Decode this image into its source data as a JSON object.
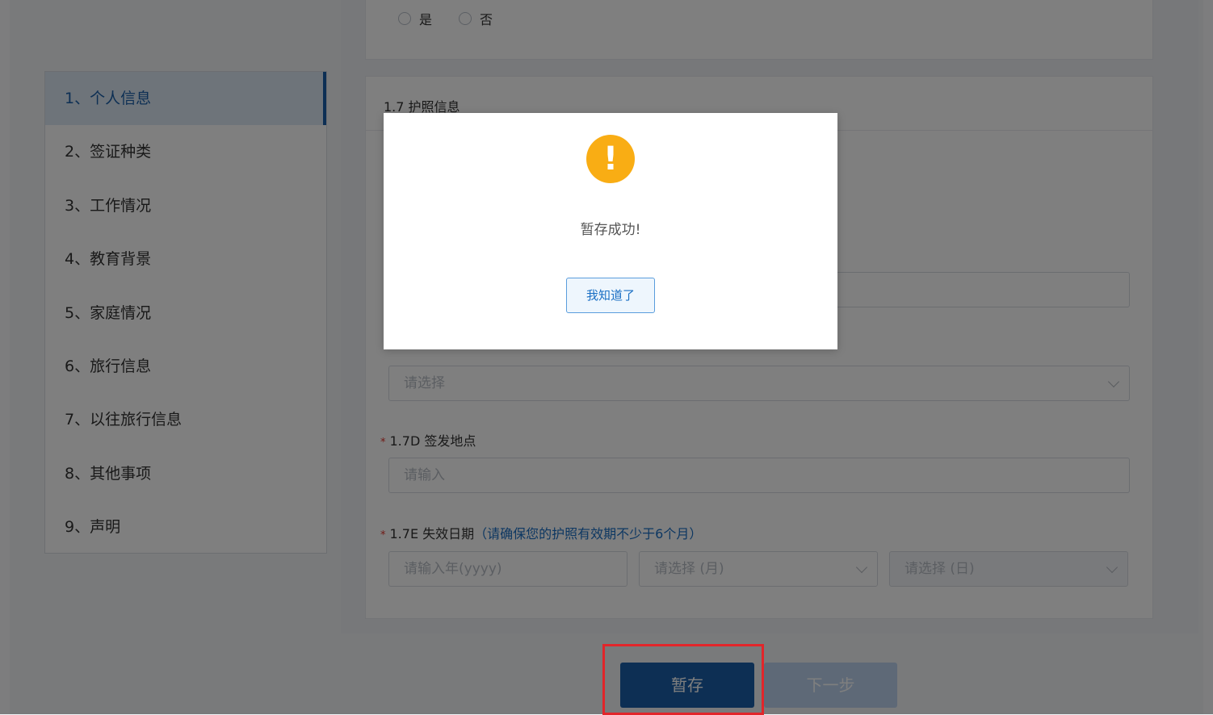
{
  "sidebar": {
    "items": [
      {
        "label": "1、个人信息",
        "active": true
      },
      {
        "label": "2、签证种类"
      },
      {
        "label": "3、工作情况"
      },
      {
        "label": "4、教育背景"
      },
      {
        "label": "5、家庭情况"
      },
      {
        "label": "6、旅行信息"
      },
      {
        "label": "7、以往旅行信息"
      },
      {
        "label": "8、其他事项"
      },
      {
        "label": "9、声明"
      }
    ]
  },
  "top_card": {
    "radio_yes": "是",
    "radio_no": "否"
  },
  "passport_section": {
    "title": "1.7 护照信息",
    "required_mark": "*",
    "select_placeholder": "请选择",
    "issue_place_label": "1.7D 签发地点",
    "issue_place_placeholder": "请输入",
    "expiry_label": "1.7E 失效日期",
    "expiry_hint": "（请确保您的护照有效期不少于6个月）",
    "year_placeholder": "请输入年(yyyy)",
    "month_placeholder": "请选择 (月)",
    "day_placeholder": "请选择 (日)"
  },
  "actions": {
    "save_label": "暂存",
    "next_label": "下一步"
  },
  "modal": {
    "icon_glyph": "!",
    "message": "暂存成功!",
    "confirm_label": "我知道了"
  },
  "colors": {
    "primary": "#1a5fa8",
    "warning": "#f9ad14",
    "required": "#e0342c",
    "hint": "#1a6fc4",
    "highlight": "#e2252a"
  }
}
